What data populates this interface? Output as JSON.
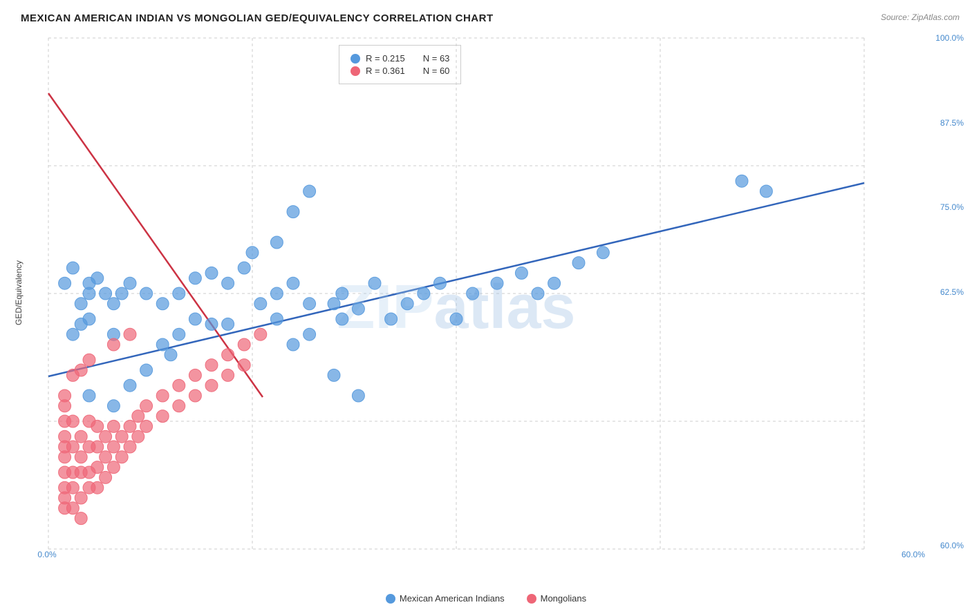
{
  "title": "MEXICAN AMERICAN INDIAN VS MONGOLIAN GED/EQUIVALENCY CORRELATION CHART",
  "source": "Source: ZipAtlas.com",
  "y_axis_label": "GED/Equivalency",
  "watermark": {
    "zip": "ZIP",
    "atlas": "atlas"
  },
  "legend": {
    "blue": {
      "r": "R = 0.215",
      "n": "N = 63"
    },
    "pink": {
      "r": "R = 0.361",
      "n": "N = 60"
    }
  },
  "y_ticks": [
    {
      "label": "100.0%",
      "pct": 0
    },
    {
      "label": "87.5%",
      "pct": 16.67
    },
    {
      "label": "75.0%",
      "pct": 33.33
    },
    {
      "label": "62.5%",
      "pct": 50
    },
    {
      "label": "60.0%",
      "pct": 100
    }
  ],
  "x_ticks": [
    {
      "label": "0.0%",
      "pct": 0
    },
    {
      "label": "60.0%",
      "pct": 100
    }
  ],
  "bottom_legend": {
    "blue_label": "Mexican American Indians",
    "pink_label": "Mongolians"
  },
  "colors": {
    "blue": "#5599dd",
    "pink": "#ee6677",
    "blue_line": "#3366bb",
    "pink_line": "#cc3344",
    "grid": "#cccccc"
  },
  "blue_dots": [
    [
      2,
      48
    ],
    [
      3,
      45
    ],
    [
      4,
      52
    ],
    [
      5,
      50
    ],
    [
      3,
      58
    ],
    [
      4,
      56
    ],
    [
      5,
      48
    ],
    [
      6,
      47
    ],
    [
      5,
      55
    ],
    [
      7,
      50
    ],
    [
      8,
      52
    ],
    [
      9,
      50
    ],
    [
      10,
      48
    ],
    [
      8,
      58
    ],
    [
      12,
      50
    ],
    [
      14,
      52
    ],
    [
      16,
      50
    ],
    [
      18,
      47
    ],
    [
      20,
      46
    ],
    [
      22,
      48
    ],
    [
      24,
      45
    ],
    [
      26,
      52
    ],
    [
      18,
      55
    ],
    [
      20,
      56
    ],
    [
      14,
      60
    ],
    [
      16,
      58
    ],
    [
      22,
      56
    ],
    [
      28,
      50
    ],
    [
      30,
      48
    ],
    [
      32,
      52
    ],
    [
      28,
      55
    ],
    [
      30,
      60
    ],
    [
      32,
      58
    ],
    [
      35,
      52
    ],
    [
      36,
      50
    ],
    [
      38,
      53
    ],
    [
      40,
      48
    ],
    [
      36,
      55
    ],
    [
      42,
      55
    ],
    [
      44,
      52
    ],
    [
      46,
      50
    ],
    [
      48,
      48
    ],
    [
      50,
      55
    ],
    [
      52,
      50
    ],
    [
      55,
      48
    ],
    [
      58,
      46
    ],
    [
      60,
      50
    ],
    [
      62,
      48
    ],
    [
      65,
      44
    ],
    [
      68,
      42
    ],
    [
      25,
      42
    ],
    [
      28,
      40
    ],
    [
      30,
      34
    ],
    [
      32,
      30
    ],
    [
      35,
      66
    ],
    [
      38,
      70
    ],
    [
      5,
      70
    ],
    [
      8,
      72
    ],
    [
      10,
      68
    ],
    [
      12,
      65
    ],
    [
      15,
      62
    ],
    [
      85,
      28
    ],
    [
      88,
      30
    ]
  ],
  "pink_dots": [
    [
      2,
      75
    ],
    [
      2,
      78
    ],
    [
      2,
      80
    ],
    [
      2,
      82
    ],
    [
      2,
      85
    ],
    [
      2,
      88
    ],
    [
      2,
      90
    ],
    [
      2,
      92
    ],
    [
      2,
      72
    ],
    [
      2,
      70
    ],
    [
      3,
      75
    ],
    [
      3,
      80
    ],
    [
      3,
      85
    ],
    [
      3,
      88
    ],
    [
      3,
      92
    ],
    [
      4,
      78
    ],
    [
      4,
      82
    ],
    [
      4,
      85
    ],
    [
      4,
      90
    ],
    [
      4,
      94
    ],
    [
      5,
      75
    ],
    [
      5,
      80
    ],
    [
      5,
      85
    ],
    [
      5,
      88
    ],
    [
      6,
      76
    ],
    [
      6,
      80
    ],
    [
      6,
      84
    ],
    [
      6,
      88
    ],
    [
      7,
      78
    ],
    [
      7,
      82
    ],
    [
      7,
      86
    ],
    [
      8,
      76
    ],
    [
      8,
      80
    ],
    [
      8,
      84
    ],
    [
      9,
      78
    ],
    [
      9,
      82
    ],
    [
      10,
      76
    ],
    [
      10,
      80
    ],
    [
      11,
      74
    ],
    [
      11,
      78
    ],
    [
      12,
      72
    ],
    [
      12,
      76
    ],
    [
      14,
      70
    ],
    [
      14,
      74
    ],
    [
      16,
      68
    ],
    [
      16,
      72
    ],
    [
      18,
      66
    ],
    [
      18,
      70
    ],
    [
      20,
      64
    ],
    [
      20,
      68
    ],
    [
      22,
      62
    ],
    [
      22,
      66
    ],
    [
      24,
      60
    ],
    [
      24,
      64
    ],
    [
      26,
      58
    ],
    [
      8,
      60
    ],
    [
      10,
      58
    ],
    [
      3,
      66
    ],
    [
      4,
      65
    ],
    [
      5,
      63
    ]
  ]
}
